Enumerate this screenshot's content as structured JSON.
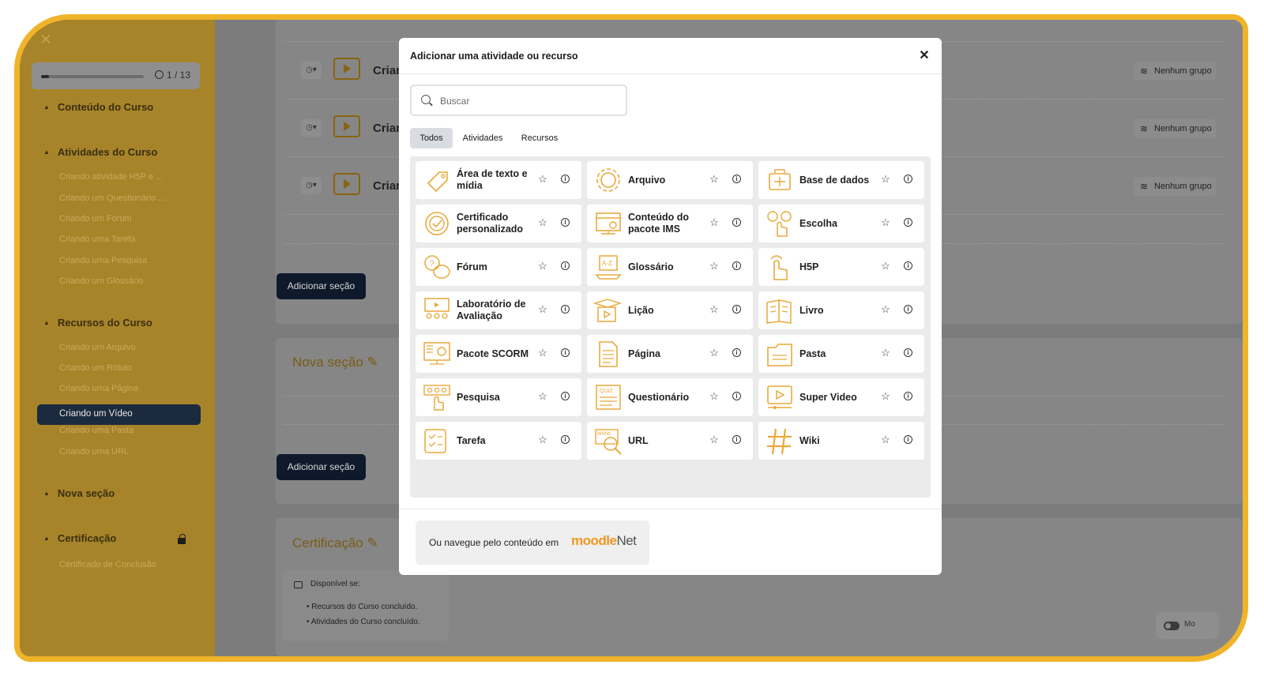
{
  "sidebar": {
    "close_icon": "close-icon",
    "progress": {
      "text": "1 / 13",
      "completed": 1,
      "total": 13
    },
    "sections": [
      {
        "label": "Conteúdo do Curso"
      },
      {
        "label": "Atividades do Curso"
      },
      {
        "label": "Recursos do Curso"
      },
      {
        "label": "Nova seção"
      },
      {
        "label": "Certificação"
      }
    ],
    "activity_items": [
      "Criando atividade H5P e ...",
      "Criando um Questionário ...",
      "Criando um Fórum",
      "Criando uma Tarefa",
      "Criando uma Pesquisa",
      "Criando um Glossário"
    ],
    "resource_items": [
      "Criando um Arquivo",
      "Criando um Rótulo",
      "Criando uma Página",
      "Criando um Vídeo",
      "Criando uma Pasta",
      "Criando uma URL"
    ],
    "active_item": "Criando um Vídeo",
    "certificate_items": [
      "Certificado de Conclusão"
    ]
  },
  "main": {
    "rows": [
      {
        "title": "Criar",
        "group": "Nenhum grupo"
      },
      {
        "title": "Criar",
        "group": "Nenhum grupo"
      },
      {
        "title": "Criar",
        "group": "Nenhum grupo"
      }
    ],
    "add_section_label": "Adicionar seção",
    "new_section_title": "Nova seção",
    "cert_section_title": "Certificação",
    "availability": {
      "label": "Disponível se:",
      "conditions": [
        "Recursos do Curso concluído.",
        "Atividades do Curso concluído."
      ]
    },
    "toggle_label": "Mo"
  },
  "modal": {
    "title": "Adicionar uma atividade ou recurso",
    "search_placeholder": "Buscar",
    "tabs": [
      "Todos",
      "Atividades",
      "Recursos"
    ],
    "active_tab": "Todos",
    "items": [
      {
        "label": "Área de texto e mídia",
        "icon": "tag-icon"
      },
      {
        "label": "Arquivo",
        "icon": "gear-file-icon"
      },
      {
        "label": "Base de dados",
        "icon": "database-icon"
      },
      {
        "label": "Certificado personalizado",
        "icon": "certificate-icon"
      },
      {
        "label": "Conteúdo do pacote IMS",
        "icon": "ims-package-icon"
      },
      {
        "label": "Escolha",
        "icon": "choice-icon"
      },
      {
        "label": "Fórum",
        "icon": "forum-icon"
      },
      {
        "label": "Glossário",
        "icon": "glossary-icon"
      },
      {
        "label": "H5P",
        "icon": "h5p-icon"
      },
      {
        "label": "Laboratório de Avaliação",
        "icon": "workshop-icon"
      },
      {
        "label": "Lição",
        "icon": "lesson-icon"
      },
      {
        "label": "Livro",
        "icon": "book-icon"
      },
      {
        "label": "Pacote SCORM",
        "icon": "scorm-icon"
      },
      {
        "label": "Página",
        "icon": "page-icon"
      },
      {
        "label": "Pasta",
        "icon": "folder-icon"
      },
      {
        "label": "Pesquisa",
        "icon": "survey-icon"
      },
      {
        "label": "Questionário",
        "icon": "quiz-icon"
      },
      {
        "label": "Super Video",
        "icon": "video-icon"
      },
      {
        "label": "Tarefa",
        "icon": "assignment-icon"
      },
      {
        "label": "URL",
        "icon": "url-icon"
      },
      {
        "label": "Wiki",
        "icon": "wiki-icon"
      }
    ],
    "footer_text": "Ou navegue pelo conteúdo em",
    "moodlenet_logo": {
      "part1": "moodle",
      "part2": "Net"
    }
  },
  "colors": {
    "accent": "#f0b429",
    "icon_orange": "#e9a93a",
    "dark_button": "#0e1a2b"
  }
}
